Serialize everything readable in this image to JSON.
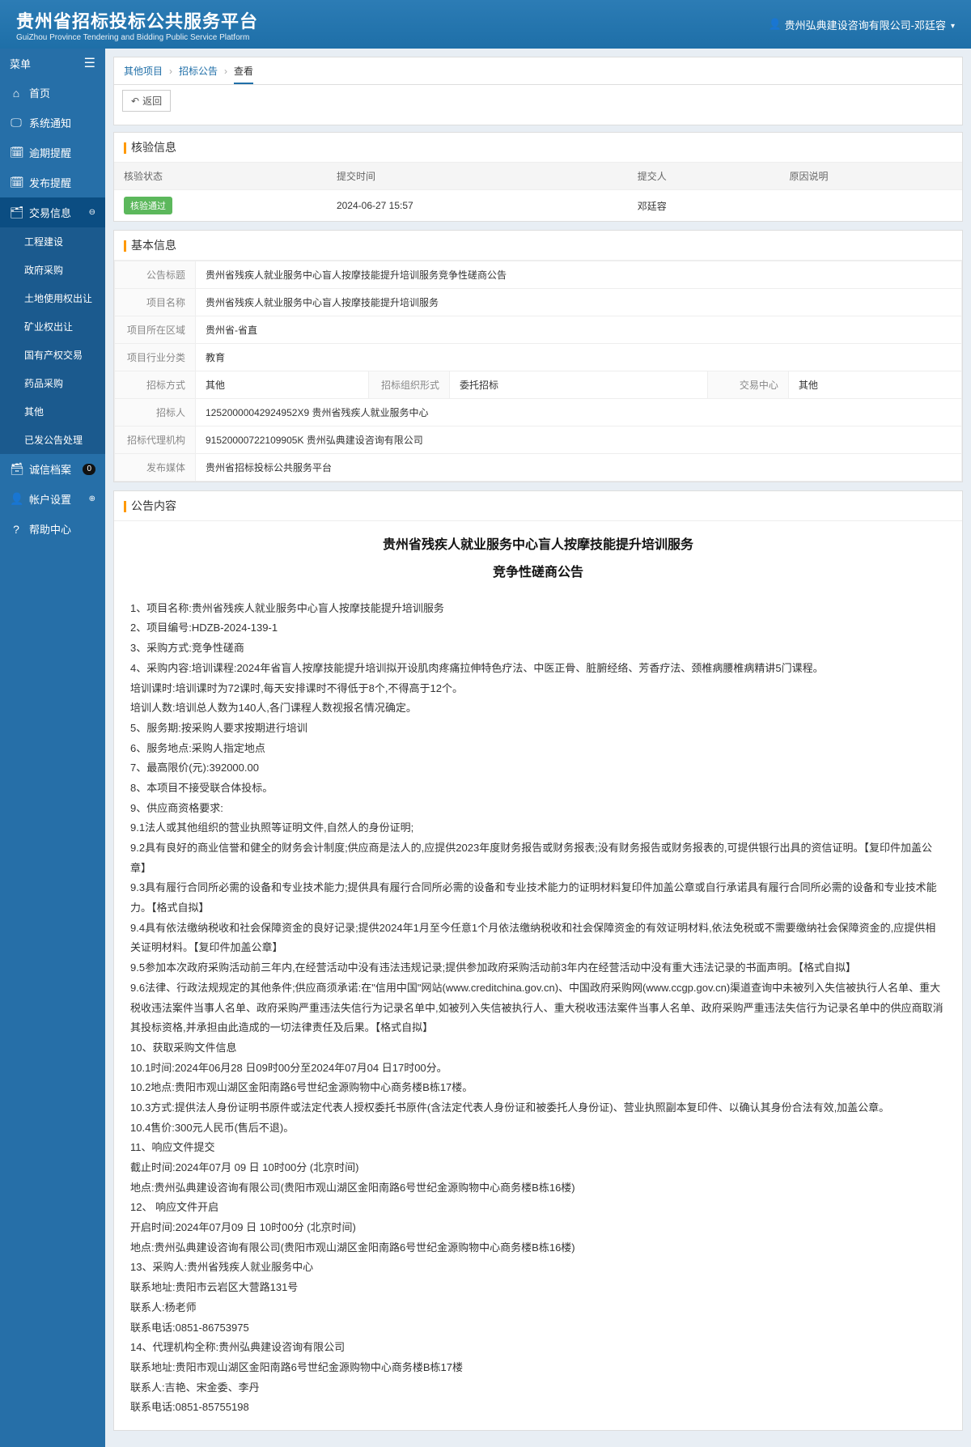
{
  "header": {
    "title_cn": "贵州省招标投标公共服务平台",
    "title_en": "GuiZhou Province Tendering and Bidding Public Service Platform",
    "user_label": "贵州弘典建设咨询有限公司-邓廷容"
  },
  "sidebar": {
    "menu_label": "菜单",
    "items": [
      {
        "icon": "⌂",
        "label": "首页"
      },
      {
        "icon": "🖵",
        "label": "系统通知"
      },
      {
        "icon": "🗓",
        "label": "逾期提醒"
      },
      {
        "icon": "🗓",
        "label": "发布提醒"
      },
      {
        "icon": "🗂",
        "label": "交易信息",
        "active": true,
        "expand": "⊖"
      },
      {
        "icon": "🗃",
        "label": "诚信档案",
        "badge": "0"
      },
      {
        "icon": "👤",
        "label": "帐户设置",
        "expand": "⊕"
      },
      {
        "icon": "?",
        "label": "帮助中心"
      }
    ],
    "sub_items": [
      "工程建设",
      "政府采购",
      "土地使用权出让",
      "矿业权出让",
      "国有产权交易",
      "药品采购",
      "其他",
      "已发公告处理"
    ]
  },
  "breadcrumb": [
    "其他项目",
    "招标公告",
    "查看"
  ],
  "return_label": "返回",
  "verify": {
    "title": "核验信息",
    "headers": [
      "核验状态",
      "提交时间",
      "提交人",
      "原因说明"
    ],
    "row": {
      "status": "核验通过",
      "time": "2024-06-27 15:57",
      "submitter": "邓廷容",
      "reason": ""
    }
  },
  "basic": {
    "title": "基本信息",
    "rows": [
      {
        "label": "公告标题",
        "value": "贵州省残疾人就业服务中心盲人按摩技能提升培训服务竞争性磋商公告"
      },
      {
        "label": "项目名称",
        "value": "贵州省残疾人就业服务中心盲人按摩技能提升培训服务"
      },
      {
        "label": "项目所在区域",
        "value": "贵州省-省直"
      },
      {
        "label": "项目行业分类",
        "value": "教育"
      }
    ],
    "row_triple": {
      "l1": "招标方式",
      "v1": "其他",
      "l2": "招标组织形式",
      "v2": "委托招标",
      "l3": "交易中心",
      "v3": "其他"
    },
    "rows2": [
      {
        "label": "招标人",
        "value": "12520000042924952X9 贵州省残疾人就业服务中心"
      },
      {
        "label": "招标代理机构",
        "value": "91520000722109905K 贵州弘典建设咨询有限公司"
      },
      {
        "label": "发布媒体",
        "value": "贵州省招标投标公共服务平台"
      }
    ]
  },
  "content": {
    "title": "公告内容",
    "doc_title": "贵州省残疾人就业服务中心盲人按摩技能提升培训服务",
    "doc_subtitle": "竞争性磋商公告",
    "lines": [
      "1、项目名称:贵州省残疾人就业服务中心盲人按摩技能提升培训服务",
      "2、项目编号:HDZB-2024-139-1",
      "3、采购方式:竞争性磋商",
      "4、采购内容:培训课程:2024年省盲人按摩技能提升培训拟开设肌肉疼痛拉伸特色疗法、中医正骨、脏腑经络、芳香疗法、颈椎病腰椎病精讲5门课程。",
      "培训课时:培训课时为72课时,每天安排课时不得低于8个,不得高于12个。",
      "培训人数:培训总人数为140人,各门课程人数视报名情况确定。",
      "5、服务期:按采购人要求按期进行培训",
      "6、服务地点:采购人指定地点",
      "7、最高限价(元):392000.00",
      "8、本项目不接受联合体投标。",
      "9、供应商资格要求:",
      "9.1法人或其他组织的营业执照等证明文件,自然人的身份证明;"
    ],
    "paragraphs": [
      "9.2具有良好的商业信誉和健全的财务会计制度;供应商是法人的,应提供2023年度财务报告或财务报表;没有财务报告或财务报表的,可提供银行出具的资信证明。【复印件加盖公章】",
      "9.3具有履行合同所必需的设备和专业技术能力;提供具有履行合同所必需的设备和专业技术能力的证明材料复印件加盖公章或自行承诺具有履行合同所必需的设备和专业技术能力。【格式自拟】",
      "9.4具有依法缴纳税收和社会保障资金的良好记录;提供2024年1月至今任意1个月依法缴纳税收和社会保障资金的有效证明材料,依法免税或不需要缴纳社会保障资金的,应提供相关证明材料。【复印件加盖公章】",
      "9.5参加本次政府采购活动前三年内,在经营活动中没有违法违规记录;提供参加政府采购活动前3年内在经营活动中没有重大违法记录的书面声明。【格式自拟】",
      "9.6法律、行政法规规定的其他条件;供应商须承诺:在\"信用中国\"网站(www.creditchina.gov.cn)、中国政府采购网(www.ccgp.gov.cn)渠道查询中未被列入失信被执行人名单、重大税收违法案件当事人名单、政府采购严重违法失信行为记录名单中,如被列入失信被执行人、重大税收违法案件当事人名单、政府采购严重违法失信行为记录名单中的供应商取消其投标资格,并承担由此造成的一切法律责任及后果。【格式自拟】"
    ],
    "lines2": [
      "10、获取采购文件信息",
      "10.1时间:2024年06月28 日09时00分至2024年07月04 日17时00分。",
      "10.2地点:贵阳市观山湖区金阳南路6号世纪金源购物中心商务楼B栋17楼。",
      "10.3方式:提供法人身份证明书原件或法定代表人授权委托书原件(含法定代表人身份证和被委托人身份证)、营业执照副本复印件、以确认其身份合法有效,加盖公章。",
      "10.4售价:300元人民币(售后不退)。",
      "11、响应文件提交",
      "截止时间:2024年07月 09 日 10时00分 (北京时间)",
      "地点:贵州弘典建设咨询有限公司(贵阳市观山湖区金阳南路6号世纪金源购物中心商务楼B栋16楼)",
      "12、 响应文件开启",
      "开启时间:2024年07月09 日 10时00分 (北京时间)",
      "地点:贵州弘典建设咨询有限公司(贵阳市观山湖区金阳南路6号世纪金源购物中心商务楼B栋16楼)",
      "13、采购人:贵州省残疾人就业服务中心",
      "联系地址:贵阳市云岩区大营路131号",
      "联系人:杨老师",
      "联系电话:0851-86753975",
      "14、代理机构全称:贵州弘典建设咨询有限公司",
      "联系地址:贵阳市观山湖区金阳南路6号世纪金源购物中心商务楼B栋17楼",
      "联系人:吉艳、宋金委、李丹",
      "联系电话:0851-85755198"
    ]
  }
}
